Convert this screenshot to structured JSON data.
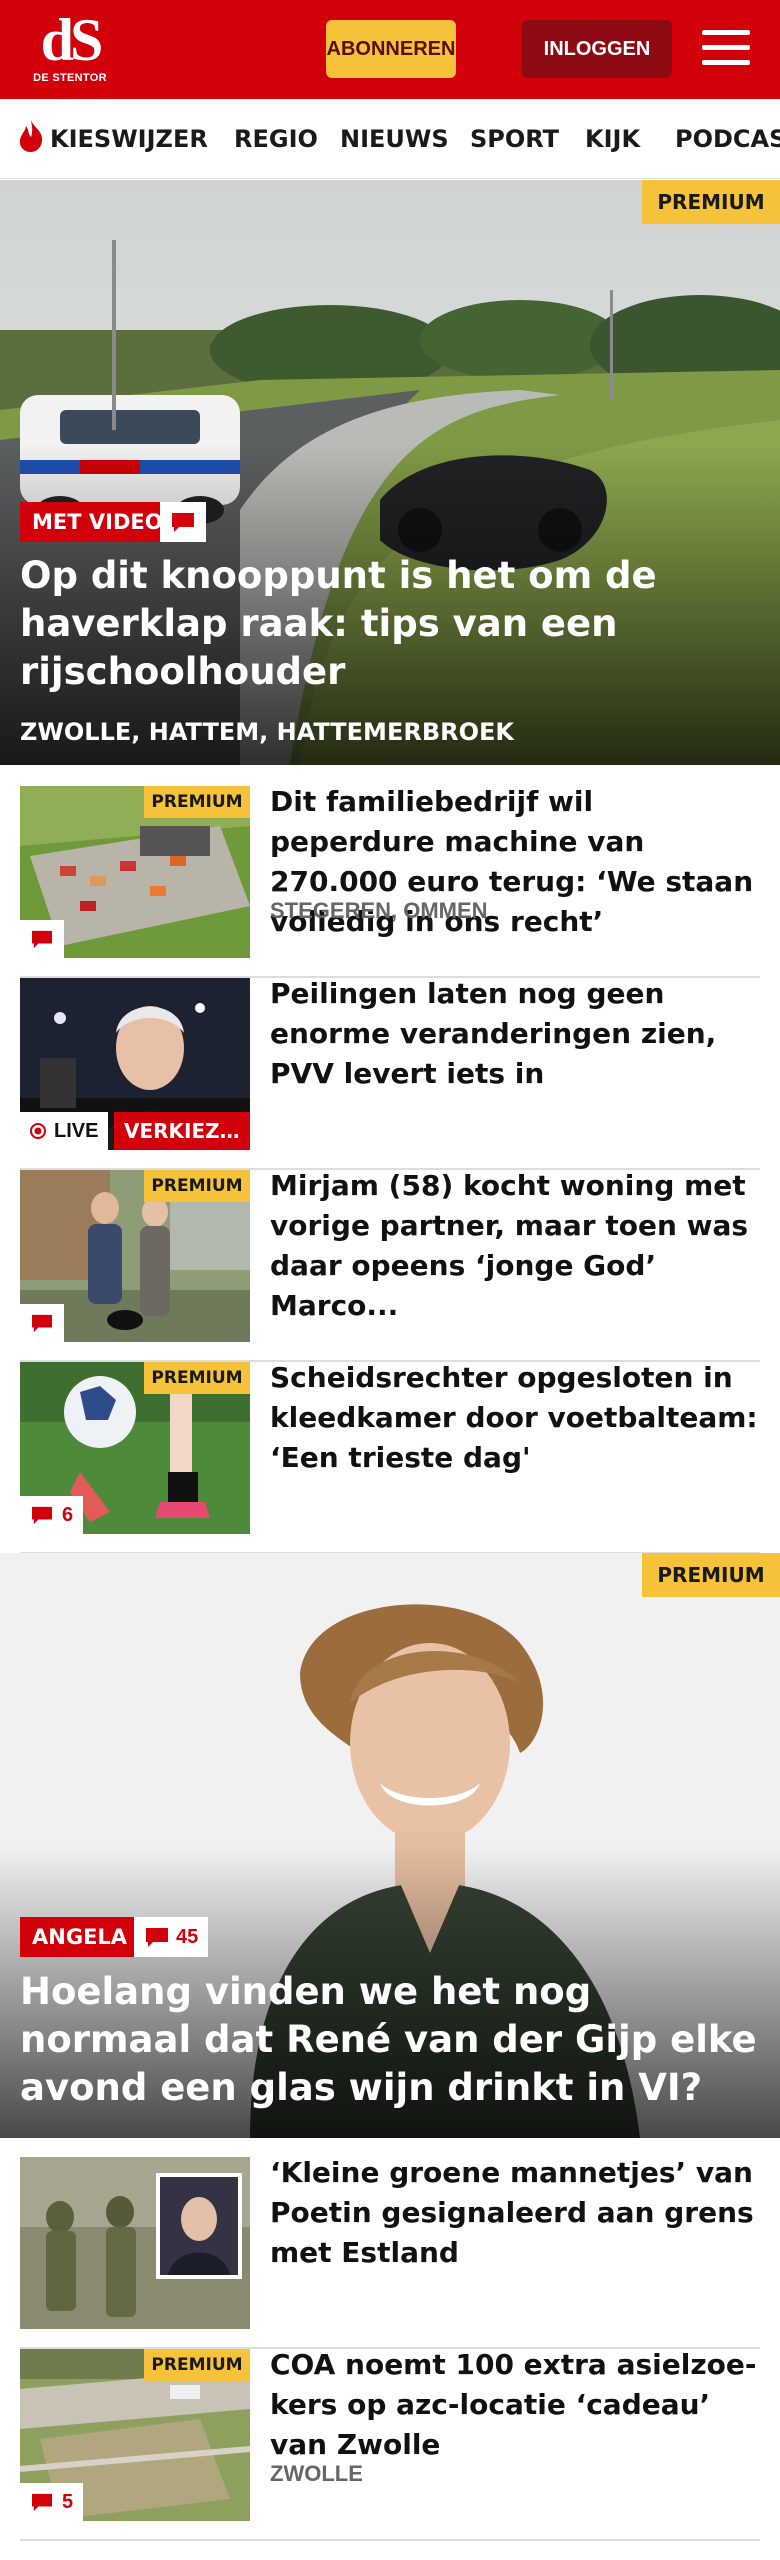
{
  "header": {
    "logo_mark": "dS",
    "logo_sub": "DE STENTOR",
    "subscribe_label": "ABONNEREN",
    "login_label": "INLOGGEN"
  },
  "nav": {
    "items": [
      "KIESWIJZER",
      "REGIO",
      "NIEUWS",
      "SPORT",
      "KIJK",
      "PODCAS"
    ]
  },
  "colors": {
    "brand_red": "#d1000b",
    "premium_yellow": "#f6c23a",
    "login_dark_red": "#8e0a13"
  },
  "articles": {
    "hero": {
      "premium_label": "PREMIUM",
      "tag_label": "MET VIDEO",
      "title": "Op dit knooppunt is het om de haverklap raak: tips van een rijschool­houder",
      "location": "ZWOLLE, HATTEM, HATTEMERBROEK"
    },
    "row1": {
      "premium_label": "PREMIUM",
      "title": "Dit familiebedrijf wil peperdure machine van 270.000 euro terug: ‘We staan volledig in ons recht’",
      "location": "STEGEREN, OMMEN"
    },
    "row2": {
      "live_label": "LIVE",
      "tag_label": "VERKIEZ…",
      "title": "Peilingen laten nog geen enorme veranderingen zien, PVV levert iets in"
    },
    "row3": {
      "premium_label": "PREMIUM",
      "title": "Mirjam (58) kocht woning met vorige partner, maar toen was daar opeens ‘jonge God’ Marco..."
    },
    "row4": {
      "premium_label": "PREMIUM",
      "comment_count": "6",
      "title": "Scheidsrechter opgesloten in kleedkamer door voetbalteam: ‘Een trieste dag'"
    },
    "big": {
      "premium_label": "PREMIUM",
      "tag_label": "ANGELA",
      "comment_count": "45",
      "title": "Hoelang vinden we het nog normaal dat René van der Gijp elke avond een glas wijn drinkt in VI?"
    },
    "row5": {
      "title": "‘Kleine groene mannetjes’ van Poetin gesignaleerd aan grens met Estland"
    },
    "row6": {
      "premium_label": "PREMIUM",
      "comment_count": "5",
      "title": "COA noemt 100 extra asielzoe­kers op azc-locatie ‘cadeau’ van Zwolle",
      "location": "ZWOLLE"
    }
  }
}
